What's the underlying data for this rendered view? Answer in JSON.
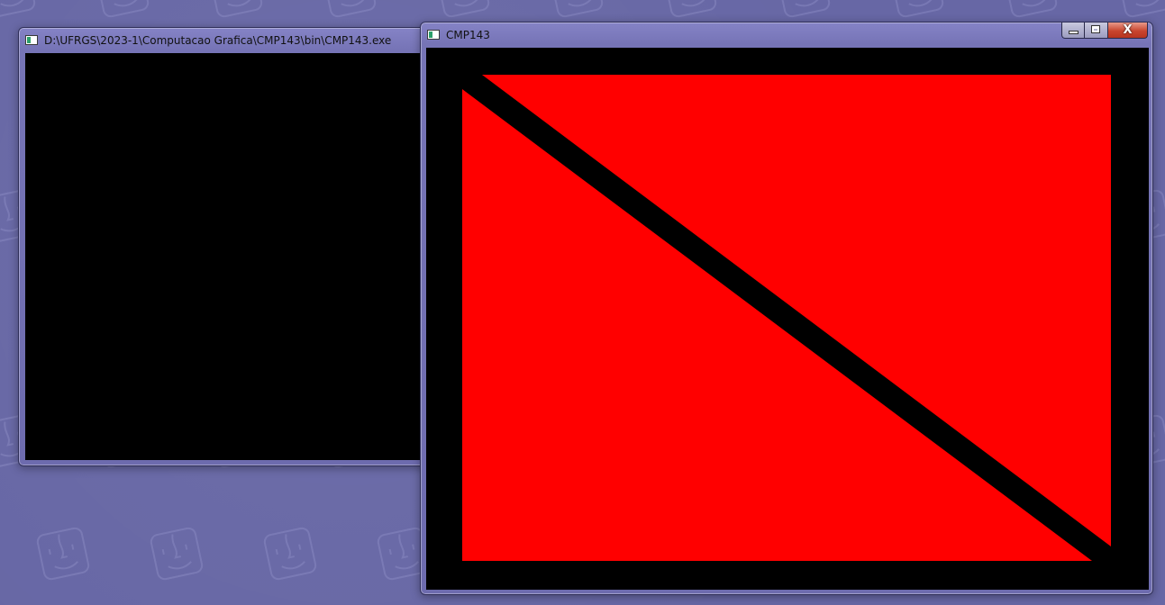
{
  "desktop": {
    "background_color": "#6767a5",
    "wallpaper_icon": "finder-face-icon"
  },
  "console_window": {
    "title": "D:\\UFRGS\\2023-1\\Computacao Grafica\\CMP143\\bin\\CMP143.exe",
    "icon": "console-app-icon",
    "client_color": "#000000"
  },
  "graphics_window": {
    "title": "CMP143",
    "icon": "window-app-icon",
    "controls": {
      "minimize_icon": "minimize-icon",
      "maximize_icon": "maximize-icon",
      "close_icon": "close-icon",
      "close_glyph": "X"
    },
    "canvas": {
      "background_color": "#000000",
      "shape_color": "#ff0000",
      "shapes": [
        "upper-right-triangle",
        "lower-left-triangle"
      ]
    }
  }
}
